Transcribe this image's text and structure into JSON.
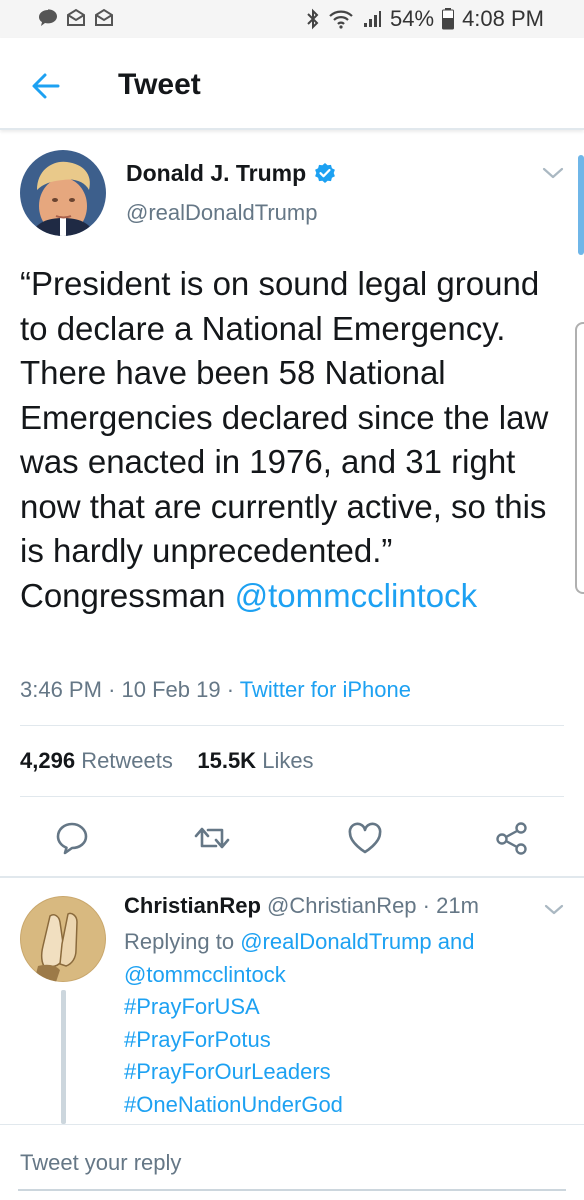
{
  "status_bar": {
    "battery": "54%",
    "time": "4:08 PM",
    "icons": [
      "message-icon",
      "mail-icon",
      "mail-icon",
      "bluetooth-icon",
      "wifi-icon",
      "signal-icon",
      "battery-icon"
    ]
  },
  "header": {
    "title": "Tweet",
    "back_icon": "arrow-left-icon"
  },
  "tweet": {
    "author_name": "Donald J. Trump",
    "handle": "@realDonaldTrump",
    "text": "“President is on sound legal ground to declare a National Emergency. There have been 58 National Emergencies declared since the law was enacted in 1976, and 31 right now that are currently active, so this is hardly unprecedented.” Congressman ",
    "mention": "@tommcclintock",
    "time": "3:46 PM",
    "date": "10 Feb 19",
    "source": "Twitter for iPhone",
    "retweet_count": "4,296",
    "retweet_label": "Retweets",
    "like_count": "15.5K",
    "like_label": "Likes"
  },
  "actions": [
    "reply-icon",
    "retweet-icon",
    "like-icon",
    "share-icon"
  ],
  "reply": {
    "author_name": "ChristianRep",
    "handle": "@ChristianRep",
    "age": "21m",
    "replying_prefix": "Replying to ",
    "replying_to_1": "@realDonaldTrump",
    "replying_and": " and",
    "replying_to_2": "@tommcclintock",
    "hashtags": [
      "#PrayForUSA",
      "#PrayForPotus",
      "#PrayForOurLeaders",
      "#OneNationUnderGod"
    ]
  },
  "compose": {
    "placeholder": "Tweet your reply"
  },
  "colors": {
    "accent": "#1da1f2",
    "text": "#14171a",
    "muted": "#657786",
    "border": "#e1e8ed"
  }
}
